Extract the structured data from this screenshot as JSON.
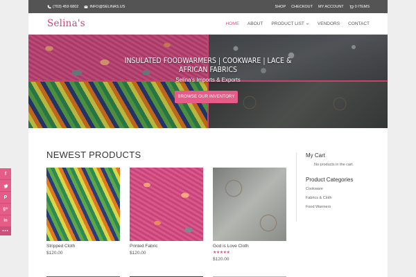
{
  "topbar": {
    "phone": "(703) 459 6802",
    "email": "INFO@SELINAS.US",
    "links": [
      "SHOP",
      "CHECKOUT",
      "MY ACCOUNT"
    ],
    "cart_label": "0 ITEMS"
  },
  "header": {
    "logo": "Selina's",
    "nav": [
      {
        "label": "HOME",
        "active": true
      },
      {
        "label": "ABOUT",
        "active": false
      },
      {
        "label": "PRODUCT LIST",
        "active": false,
        "dropdown": true
      },
      {
        "label": "VENDORS",
        "active": false
      },
      {
        "label": "CONTACT",
        "active": false
      }
    ]
  },
  "hero": {
    "title": "INSULATED FOODWARMERS | COOKWARE | LACE & AFRICAN FABRICS",
    "subtitle": "Selina's Imports & Exports",
    "cta": "BROWSE OUR INVENTORY"
  },
  "main": {
    "section_title": "NEWEST PRODUCTS",
    "products": [
      {
        "name": "Stripped Cloth",
        "price": "$120.00",
        "rating": null
      },
      {
        "name": "Printed Fabric",
        "price": "$120.00",
        "rating": null
      },
      {
        "name": "God is Love Cloth",
        "price": "$120.00",
        "rating": "★★★★★"
      }
    ]
  },
  "sidebar": {
    "cart_title": "My Cart",
    "cart_empty": "No products in the cart.",
    "categories_title": "Product Categories",
    "categories": [
      "Cookware",
      "Fabrics & Cloth",
      "Food Warmers"
    ]
  },
  "share": {
    "icons": [
      "facebook-icon",
      "twitter-icon",
      "pinterest-icon",
      "google-plus-icon",
      "linkedin-icon",
      "more-icon"
    ]
  },
  "colors": {
    "accent": "#e65c88",
    "topbar": "#545454",
    "logo": "#d6407d"
  }
}
